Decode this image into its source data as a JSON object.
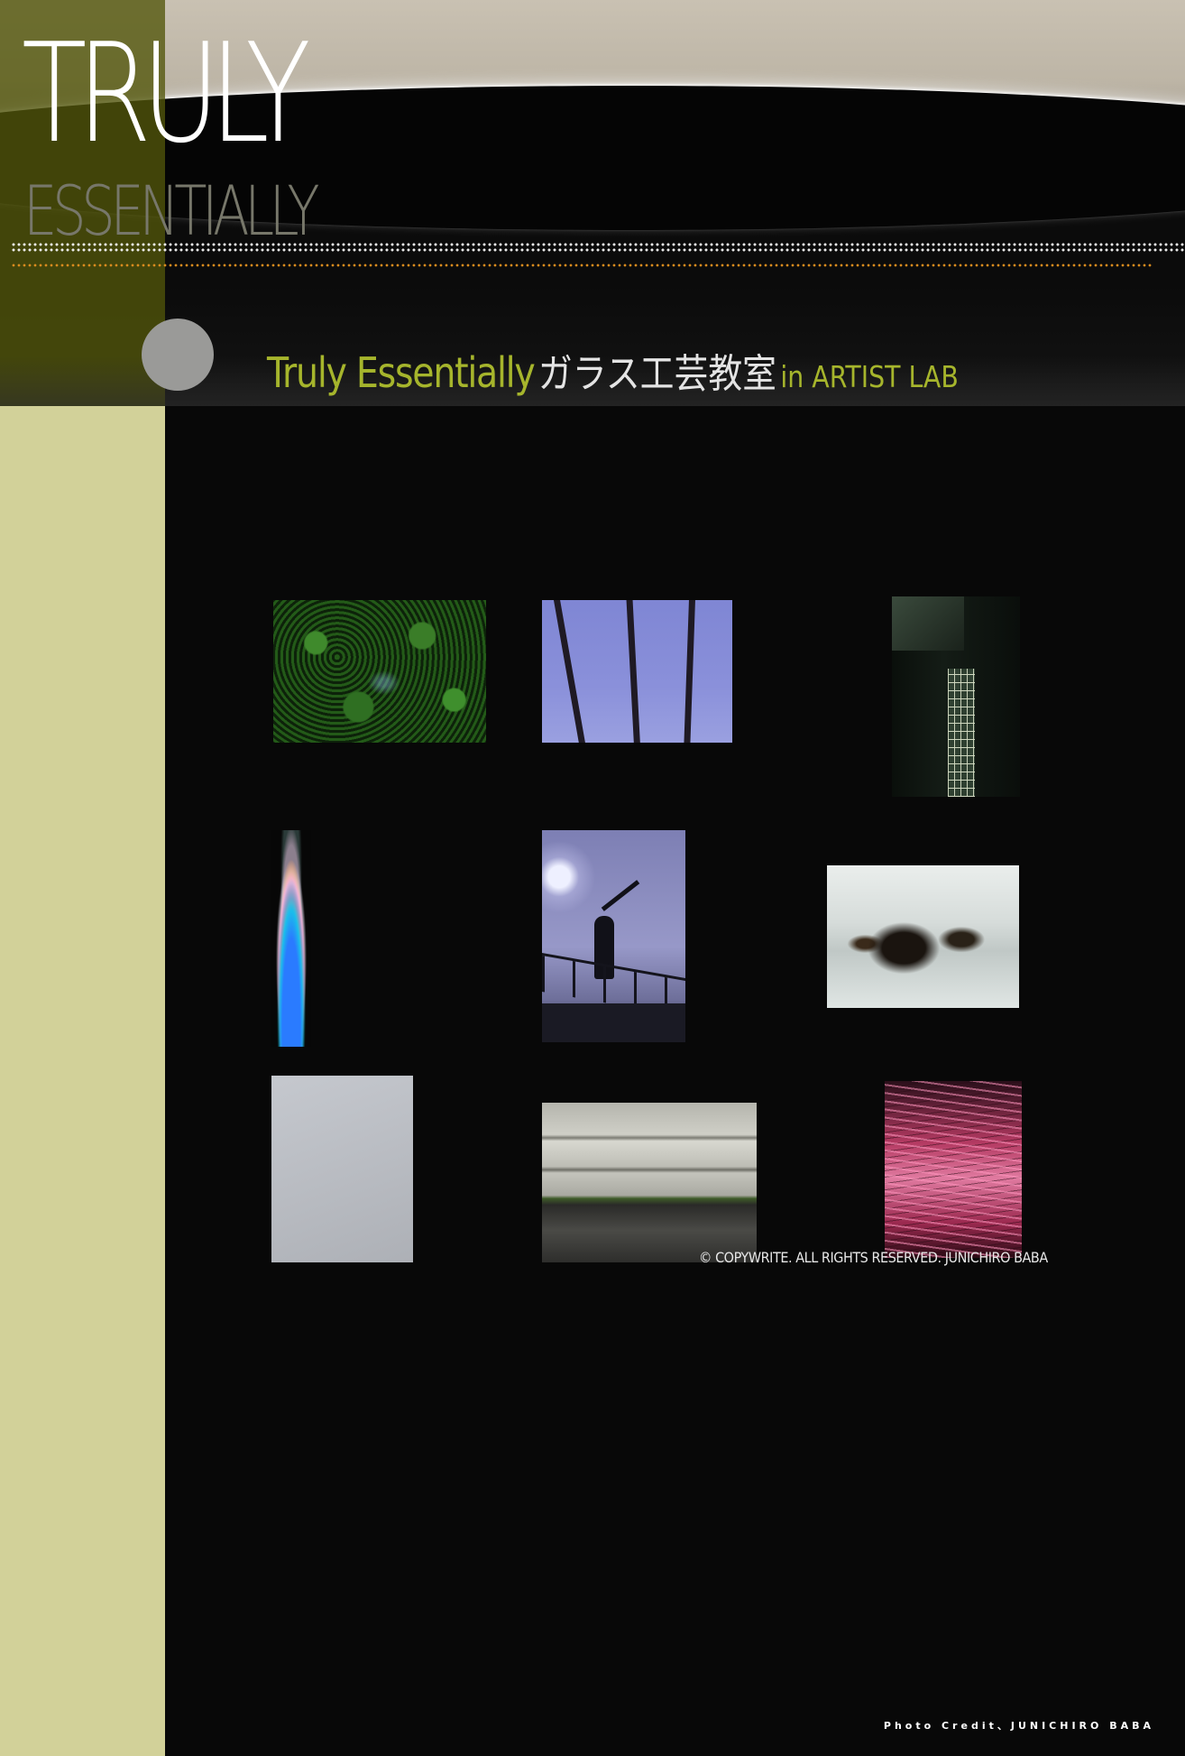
{
  "header": {
    "title_main": "TRULY",
    "title_sub": "ESSENTIALLY",
    "subtitle_en": "Truly Essentially",
    "subtitle_jp": "ガラス工芸教室",
    "subtitle_lab": "in ARTIST LAB"
  },
  "colors": {
    "sidebar": "#d2d199",
    "background": "#080808",
    "accent_green": "#a6b52c",
    "dots_orange": "#d98b1e"
  },
  "gallery": {
    "photos": [
      {
        "name": "leaves"
      },
      {
        "name": "palms"
      },
      {
        "name": "building"
      },
      {
        "name": "lights"
      },
      {
        "name": "bridge"
      },
      {
        "name": "rust"
      },
      {
        "name": "white"
      },
      {
        "name": "wall"
      },
      {
        "name": "red"
      }
    ]
  },
  "footer": {
    "copyright": "© COPYWRITE. ALL RIGHTS RESERVED. JUNICHIRO BABA",
    "photo_credit": "Photo Credit、JUNICHIRO BABA"
  }
}
